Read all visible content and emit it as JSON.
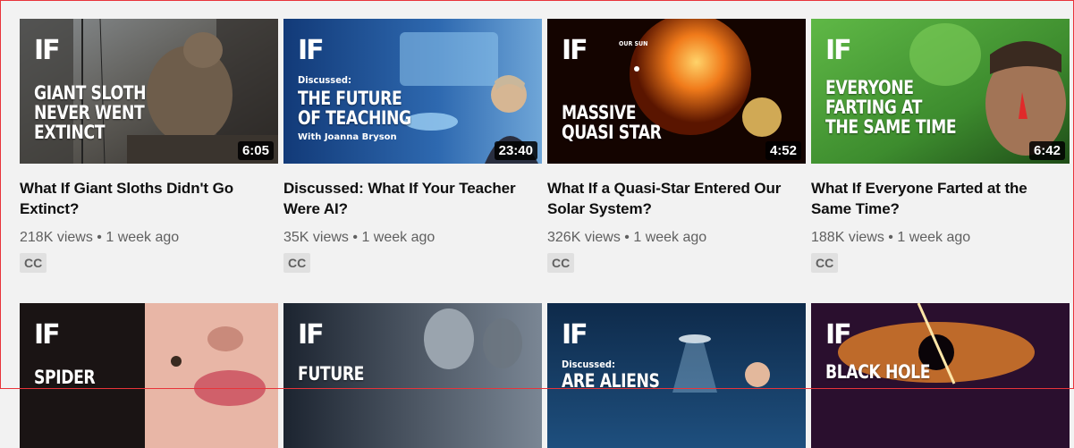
{
  "videos": [
    {
      "title": "What If Giant Sloths Didn't Go Extinct?",
      "views": "218K views",
      "age": "1 week ago",
      "duration": "6:05",
      "badge": "CC",
      "thumb_logo": "IF",
      "thumb_kicker": "",
      "thumb_headline": "GIANT SLOTH\nNEVER WENT\nEXTINCT",
      "thumb_byline": ""
    },
    {
      "title": "Discussed: What If Your Teacher Were AI?",
      "views": "35K views",
      "age": "1 week ago",
      "duration": "23:40",
      "badge": "CC",
      "thumb_logo": "IF",
      "thumb_kicker": "Discussed:",
      "thumb_headline": "THE FUTURE\nOF TEACHING",
      "thumb_byline": "With Joanna Bryson"
    },
    {
      "title": "What If a Quasi-Star Entered Our Solar System?",
      "views": "326K views",
      "age": "1 week ago",
      "duration": "4:52",
      "badge": "CC",
      "thumb_logo": "IF",
      "thumb_kicker": "OUR SUN",
      "thumb_headline": "MASSIVE\nQUASI STAR",
      "thumb_byline": ""
    },
    {
      "title": "What If Everyone Farted at the Same Time?",
      "views": "188K views",
      "age": "1 week ago",
      "duration": "6:42",
      "badge": "CC",
      "thumb_logo": "IF",
      "thumb_kicker": "",
      "thumb_headline": "EVERYONE\nFARTING AT\nTHE SAME TIME",
      "thumb_byline": ""
    },
    {
      "thumb_logo": "IF",
      "thumb_kicker": "",
      "thumb_headline": "SPIDER"
    },
    {
      "thumb_logo": "IF",
      "thumb_kicker": "",
      "thumb_headline": "FUTURE"
    },
    {
      "thumb_logo": "IF",
      "thumb_kicker": "Discussed:",
      "thumb_headline": "ARE ALIENS"
    },
    {
      "thumb_logo": "IF",
      "thumb_kicker": "",
      "thumb_headline": "BLACK HOLE"
    }
  ],
  "separator": "•",
  "colors": {
    "accent_border": "#e8343a",
    "title": "#0f0f0f",
    "meta": "#606060",
    "background": "#f2f2f2"
  }
}
